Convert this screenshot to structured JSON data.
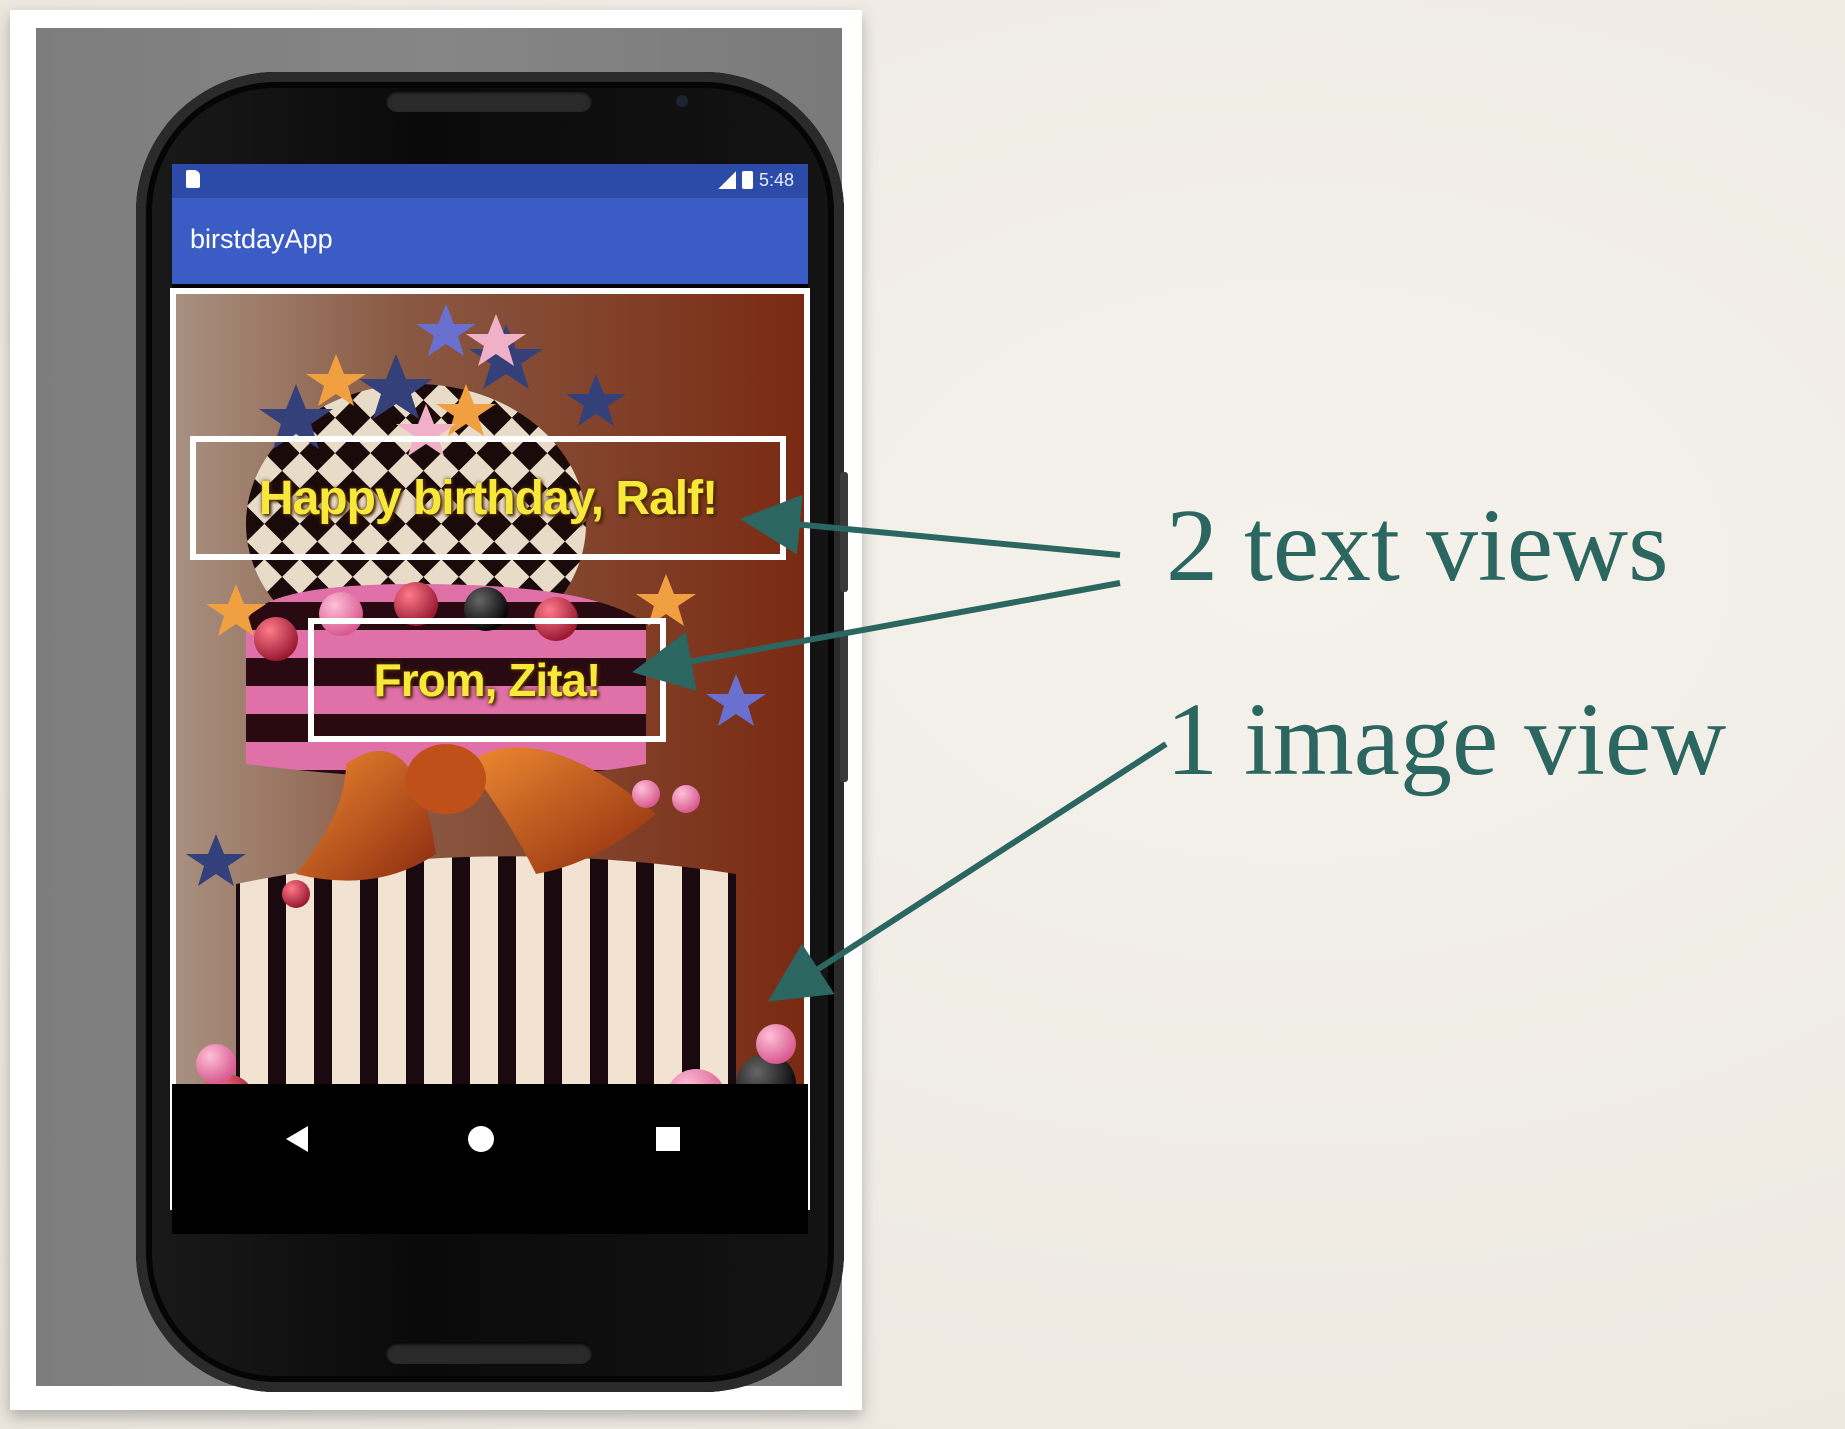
{
  "phone": {
    "status_bar": {
      "time": "5:48"
    },
    "app_bar": {
      "title": "birstdayApp"
    },
    "text_views": [
      "Happy birthday, Ralf!",
      "From, Zita!"
    ],
    "nav_bar": {
      "buttons": [
        "back",
        "home",
        "recent-apps"
      ]
    }
  },
  "annotations": {
    "text_views_label": "2 text views",
    "image_view_label": "1 image view"
  },
  "colors": {
    "annotation": "#2b6660",
    "status_bar": "#2c4aa8",
    "app_bar": "#3b5cc4",
    "text_view_text": "#f7e83a",
    "highlight_box": "#ffffff"
  },
  "icons": [
    "sd-card-icon",
    "signal-icon",
    "battery-icon",
    "back-icon",
    "home-icon",
    "recent-apps-icon"
  ]
}
